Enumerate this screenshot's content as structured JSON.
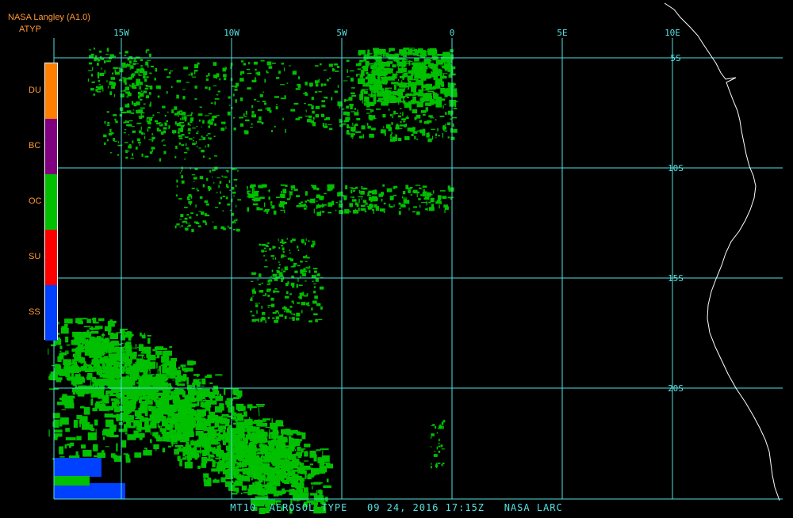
{
  "header": {
    "agency": "NASA Langley (A1.0)",
    "product": "ATYP"
  },
  "legend": {
    "items": [
      {
        "code": "DU",
        "color": "#ff8000"
      },
      {
        "code": "BC",
        "color": "#800080"
      },
      {
        "code": "OC",
        "color": "#00c000"
      },
      {
        "code": "SU",
        "color": "#ff0000"
      },
      {
        "code": "SS",
        "color": "#0040ff"
      }
    ]
  },
  "map": {
    "lon_labels": [
      "15W",
      "10W",
      "5W",
      "0",
      "5E",
      "10E"
    ],
    "lat_labels": [
      "5S",
      "10S",
      "15S",
      "20S"
    ],
    "grid_color": "#55e0e0",
    "aerosol_color": "#00c000",
    "coast_color": "#ffffff"
  },
  "footer": {
    "text": "MT10  AEROSOL TYPE   09 24, 2016 17:15Z   NASA LARC"
  }
}
